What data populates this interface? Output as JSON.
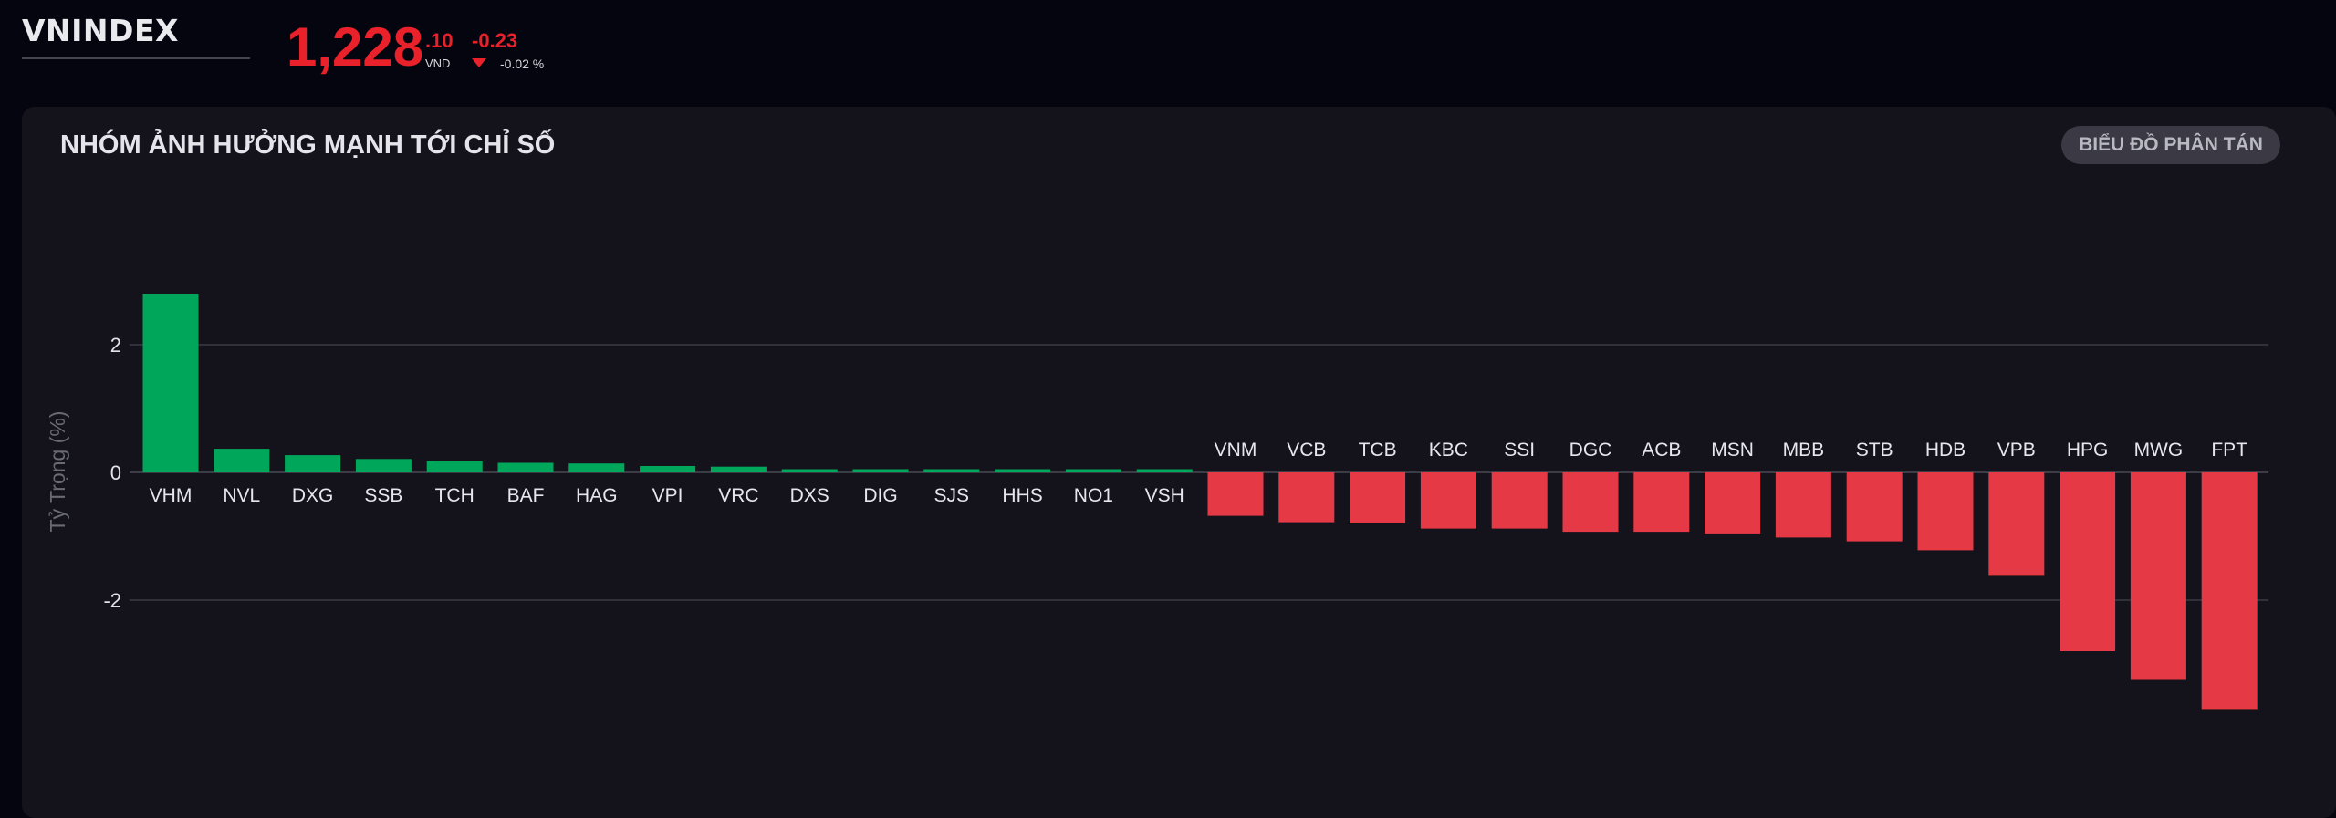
{
  "header": {
    "index_name": "VNINDEX",
    "price_main": "1,228",
    "price_decimal": ".10",
    "price_unit": "VND",
    "change_abs": "-0.23",
    "change_pct": "-0.02 %",
    "down_color": "#e8212a",
    "arrow_icon": "triangle-down-icon"
  },
  "panel": {
    "title": "NHÓM ẢNH HƯỞNG MẠNH TỚI CHỈ SỐ",
    "scatter_button_label": "BIỂU ĐỒ PHÂN TÁN"
  },
  "chart_data": {
    "type": "bar",
    "title": "",
    "xlabel": "",
    "ylabel": "Tỷ Trọng (%)",
    "ylim": [
      -3.9,
      3.9
    ],
    "yticks": [
      -2,
      0,
      2
    ],
    "grid": true,
    "positive_color": "#00a65a",
    "negative_color": "#e63946",
    "categories": [
      "VHM",
      "NVL",
      "DXG",
      "SSB",
      "TCH",
      "BAF",
      "HAG",
      "VPI",
      "VRC",
      "DXS",
      "DIG",
      "SJS",
      "HHS",
      "NO1",
      "VSH",
      "VNM",
      "VCB",
      "TCB",
      "KBC",
      "SSI",
      "DGC",
      "ACB",
      "MSN",
      "MBB",
      "STB",
      "HDB",
      "VPB",
      "HPG",
      "MWG",
      "FPT"
    ],
    "values": [
      2.8,
      0.37,
      0.27,
      0.21,
      0.18,
      0.15,
      0.14,
      0.1,
      0.09,
      0.05,
      0.05,
      0.05,
      0.05,
      0.05,
      0.05,
      -0.68,
      -0.78,
      -0.8,
      -0.88,
      -0.88,
      -0.93,
      -0.93,
      -0.97,
      -1.02,
      -1.08,
      -1.22,
      -1.62,
      -2.8,
      -3.25,
      -3.72
    ]
  }
}
